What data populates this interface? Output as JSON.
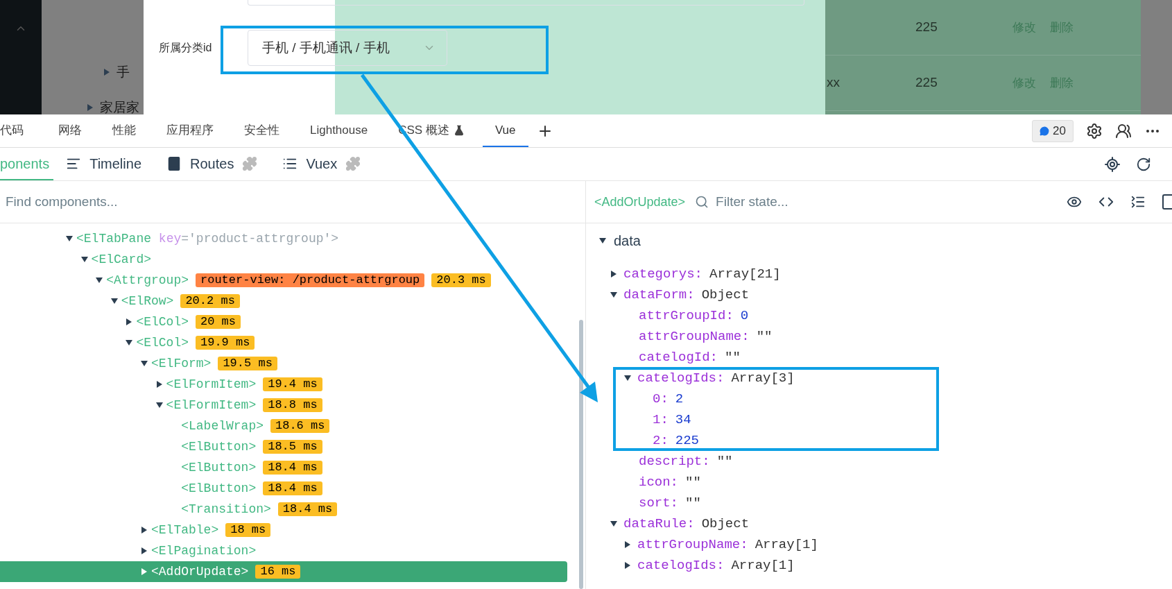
{
  "page": {
    "sidebar": {
      "items": [
        {
          "label": "手",
          "expanded": false
        },
        {
          "label": "家居家",
          "expanded": false
        }
      ]
    },
    "dialog": {
      "field_label": "所属分类id",
      "select_value": "手机 / 手机通讯 / 手机"
    },
    "table": {
      "rows": [
        {
          "id": "225",
          "actions": [
            "修改",
            "删除"
          ]
        },
        {
          "column_1": "xx",
          "id": "225",
          "actions": [
            "修改",
            "删除"
          ]
        }
      ]
    }
  },
  "devtools_tabs": [
    {
      "label": "代码",
      "selected": false
    },
    {
      "label": "网络",
      "selected": false
    },
    {
      "label": "性能",
      "selected": false
    },
    {
      "label": "应用程序",
      "selected": false
    },
    {
      "label": "安全性",
      "selected": false
    },
    {
      "label": "Lighthouse",
      "selected": false
    },
    {
      "label": "CSS 概述",
      "selected": false,
      "kind": "experimental"
    },
    {
      "label": "Vue",
      "selected": true
    }
  ],
  "issues_badge": "20",
  "vue_tabs": [
    {
      "label": "ponents",
      "selected": true,
      "kind": "components"
    },
    {
      "label": "Timeline",
      "selected": false,
      "kind": "timeline"
    },
    {
      "label": "Routes",
      "selected": false,
      "kind": "routes"
    },
    {
      "label": "Vuex",
      "selected": false,
      "kind": "vuex"
    }
  ],
  "component_search": {
    "placeholder": "Find components..."
  },
  "inspected_component": "<AddOrUpdate>",
  "state_filter": {
    "placeholder": "Filter state..."
  },
  "component_tree": [
    {
      "tag": "<ElTabPane",
      "attr": {
        "name": "key",
        "value": "='product-attrgroup'>"
      },
      "expanded": true,
      "selected": false,
      "children": [
        {
          "tag": "<ElCard>",
          "expanded": true,
          "selected": false,
          "children": [
            {
              "tag": "<Attrgroup>",
              "expanded": true,
              "selected": false,
              "badges": [
                {
                  "text": "router-view: /product-attrgroup",
                  "color": "#ff8344"
                },
                {
                  "text": "20.3 ms",
                  "color": "#fbbd23"
                }
              ],
              "children": [
                {
                  "tag": "<ElRow>",
                  "expanded": true,
                  "selected": false,
                  "badges": [
                    {
                      "text": "20.2 ms",
                      "color": "#fbbd23"
                    }
                  ],
                  "children": [
                    {
                      "tag": "<ElCol>",
                      "expanded": false,
                      "selected": false,
                      "badges": [
                        {
                          "text": "20 ms",
                          "color": "#fbbd23"
                        }
                      ]
                    },
                    {
                      "tag": "<ElCol>",
                      "expanded": true,
                      "selected": false,
                      "badges": [
                        {
                          "text": "19.9 ms",
                          "color": "#fbbd23"
                        }
                      ],
                      "children": [
                        {
                          "tag": "<ElForm>",
                          "expanded": true,
                          "selected": false,
                          "badges": [
                            {
                              "text": "19.5 ms",
                              "color": "#fbbd23"
                            }
                          ],
                          "children": [
                            {
                              "tag": "<ElFormItem>",
                              "expanded": false,
                              "selected": false,
                              "badges": [
                                {
                                  "text": "19.4 ms",
                                  "color": "#fbbd23"
                                }
                              ]
                            },
                            {
                              "tag": "<ElFormItem>",
                              "expanded": true,
                              "selected": false,
                              "badges": [
                                {
                                  "text": "18.8 ms",
                                  "color": "#fbbd23"
                                }
                              ],
                              "children": [
                                {
                                  "tag": "<LabelWrap>",
                                  "selected": false,
                                  "badges": [
                                    {
                                      "text": "18.6 ms",
                                      "color": "#fbbd23"
                                    }
                                  ]
                                },
                                {
                                  "tag": "<ElButton>",
                                  "selected": false,
                                  "badges": [
                                    {
                                      "text": "18.5 ms",
                                      "color": "#fbbd23"
                                    }
                                  ]
                                },
                                {
                                  "tag": "<ElButton>",
                                  "selected": false,
                                  "badges": [
                                    {
                                      "text": "18.4 ms",
                                      "color": "#fbbd23"
                                    }
                                  ]
                                },
                                {
                                  "tag": "<ElButton>",
                                  "selected": false,
                                  "badges": [
                                    {
                                      "text": "18.4 ms",
                                      "color": "#fbbd23"
                                    }
                                  ]
                                },
                                {
                                  "tag": "<Transition>",
                                  "selected": false,
                                  "badges": [
                                    {
                                      "text": "18.4 ms",
                                      "color": "#fbbd23"
                                    }
                                  ]
                                }
                              ]
                            }
                          ]
                        },
                        {
                          "tag": "<ElTable>",
                          "expanded": false,
                          "selected": false,
                          "badges": [
                            {
                              "text": "18 ms",
                              "color": "#fbbd23"
                            }
                          ]
                        },
                        {
                          "tag": "<ElPagination>",
                          "expanded": false,
                          "selected": false
                        },
                        {
                          "tag": "<AddOrUpdate>",
                          "expanded": false,
                          "selected": true,
                          "badges": [
                            {
                              "text": "16 ms",
                              "color": "#fbbd23"
                            }
                          ]
                        }
                      ]
                    }
                  ]
                }
              ]
            }
          ]
        }
      ]
    }
  ],
  "state": [
    {
      "section": "data",
      "expanded": true,
      "children": [
        {
          "key": "categorys:",
          "value": "Array[21]",
          "kind": "type",
          "expanded": false
        },
        {
          "key": "dataForm:",
          "value": "Object",
          "kind": "type",
          "expanded": true,
          "children": [
            {
              "key": "attrGroupId:",
              "value": "0",
              "kind": "number"
            },
            {
              "key": "attrGroupName:",
              "value": "\"\"",
              "kind": "string"
            },
            {
              "key": "catelogId:",
              "value": "\"\"",
              "kind": "string"
            },
            {
              "key": "catelogIds:",
              "value": "Array[3]",
              "kind": "type",
              "expanded": true,
              "children": [
                {
                  "key": "0:",
                  "value": "2",
                  "kind": "number"
                },
                {
                  "key": "1:",
                  "value": "34",
                  "kind": "number"
                },
                {
                  "key": "2:",
                  "value": "225",
                  "kind": "number"
                }
              ]
            },
            {
              "key": "descript:",
              "value": "\"\"",
              "kind": "string"
            },
            {
              "key": "icon:",
              "value": "\"\"",
              "kind": "string"
            },
            {
              "key": "sort:",
              "value": "\"\"",
              "kind": "string"
            }
          ]
        },
        {
          "key": "dataRule:",
          "value": "Object",
          "kind": "type",
          "expanded": true,
          "children": [
            {
              "key": "attrGroupName:",
              "value": "Array[1]",
              "kind": "type",
              "expanded": false
            },
            {
              "key": "catelogIds:",
              "value": "Array[1]",
              "kind": "type",
              "expanded": false
            }
          ]
        }
      ]
    }
  ]
}
